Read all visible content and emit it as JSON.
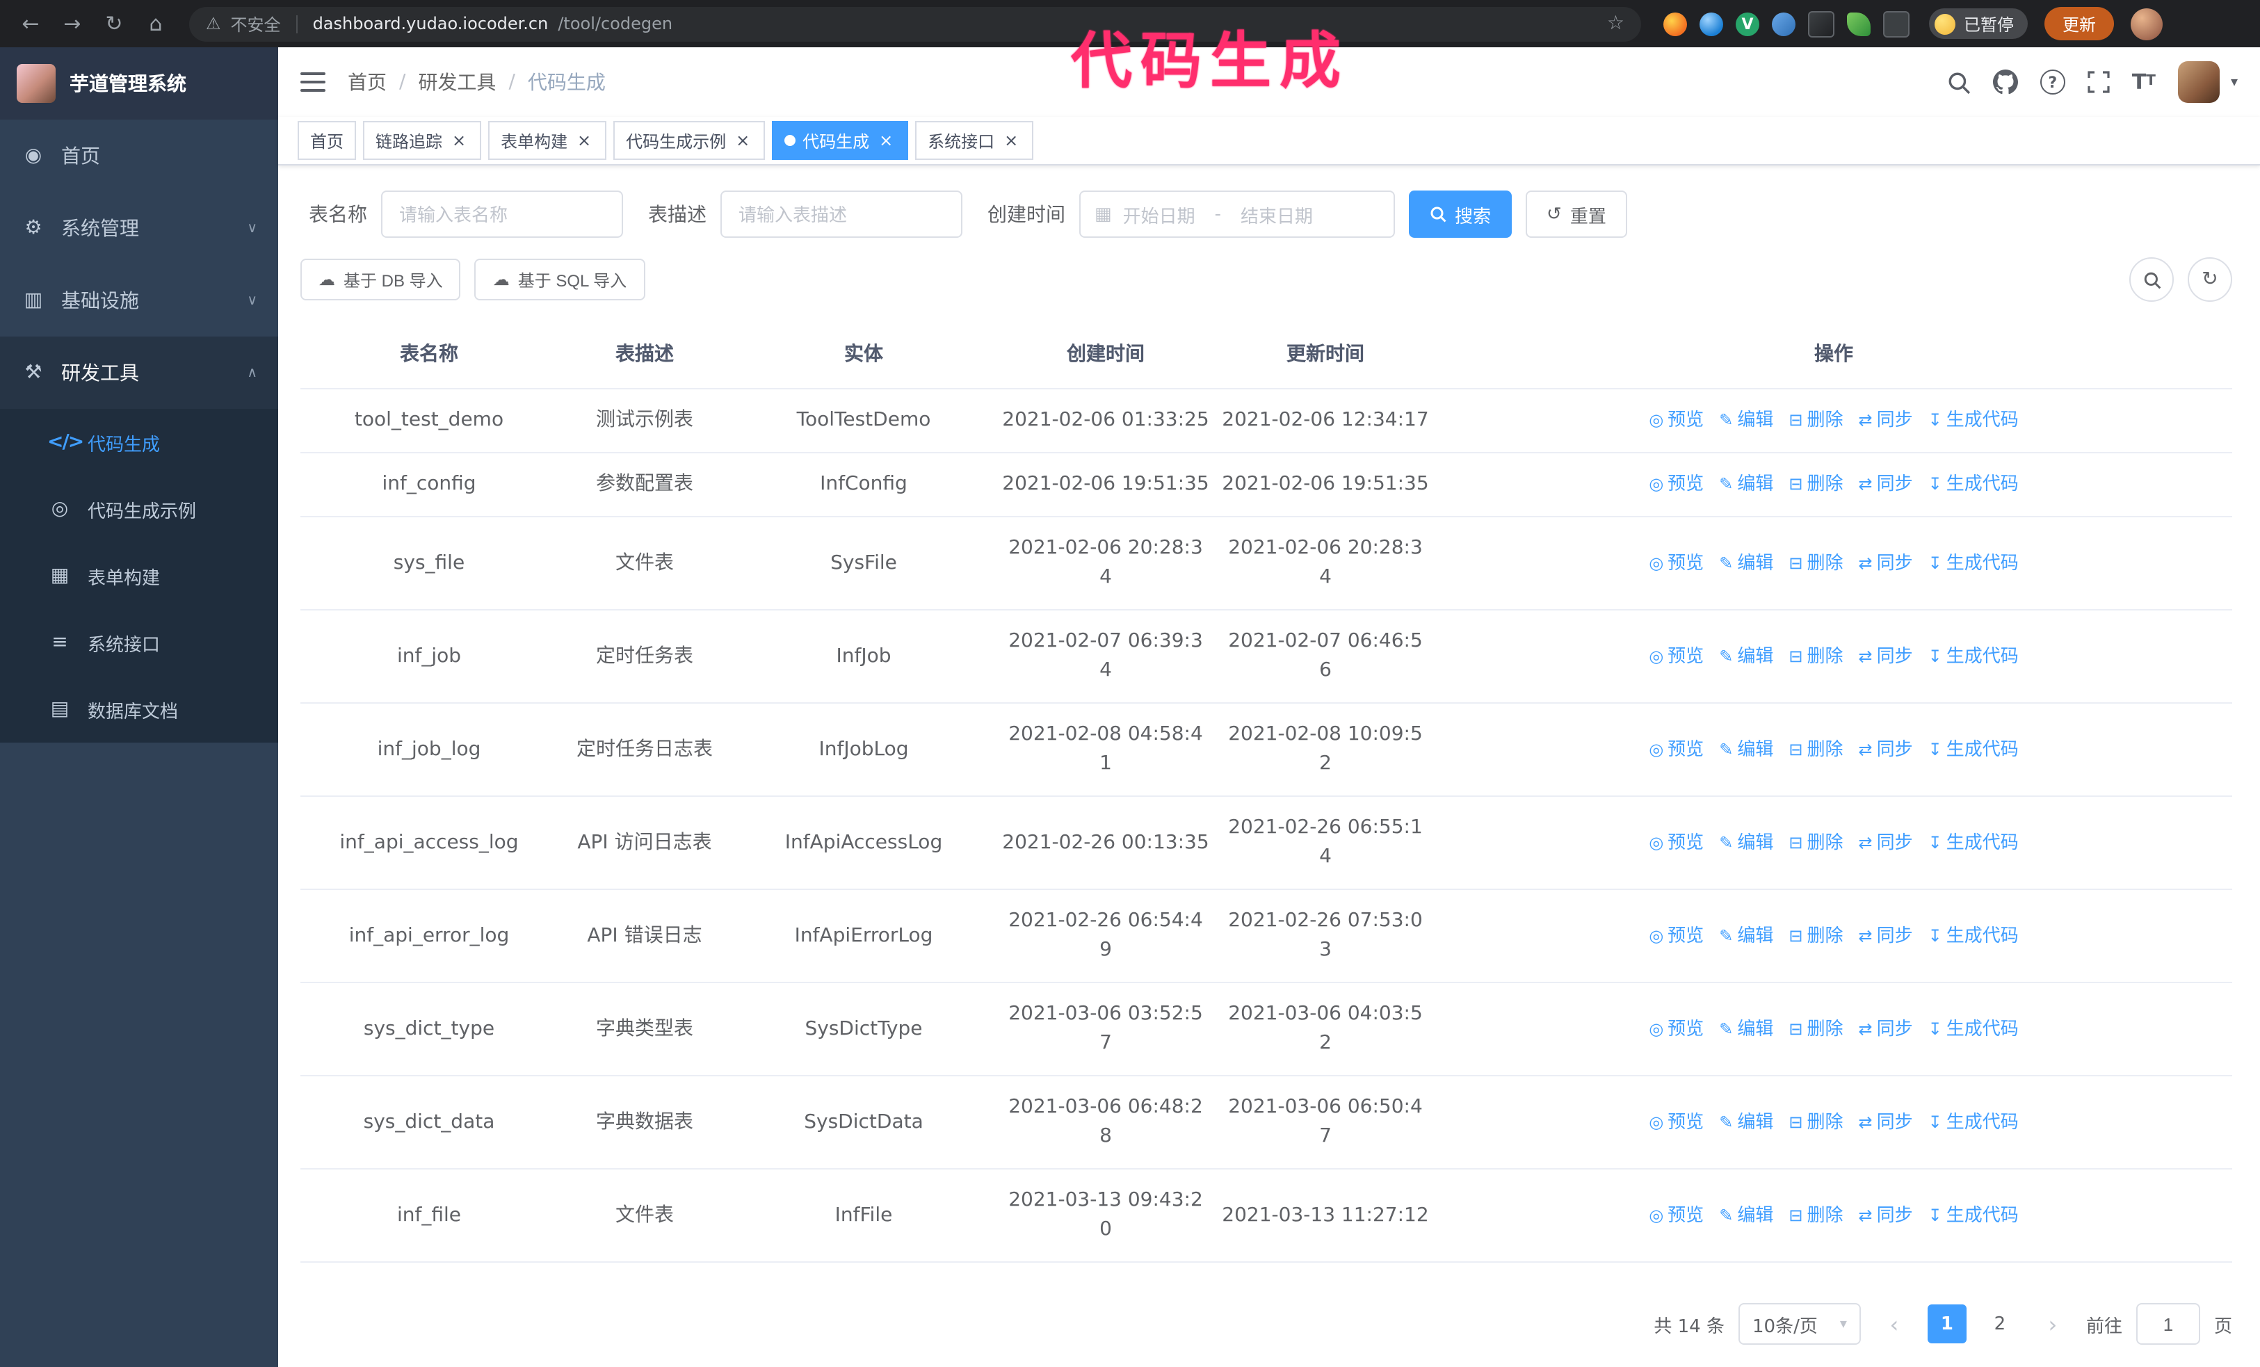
{
  "annotation": {
    "text": "代码生成",
    "color": "#ff2e6d"
  },
  "browser": {
    "security_label": "不安全",
    "url_domain": "dashboard.yudao.iocoder.cn",
    "url_path": "/tool/codegen",
    "paused_badge": "已暂停",
    "update_button": "更新"
  },
  "sidebar": {
    "logo_title": "芋道管理系统",
    "items": [
      {
        "label": "首页"
      },
      {
        "label": "系统管理"
      },
      {
        "label": "基础设施"
      },
      {
        "label": "研发工具"
      }
    ],
    "submenu": [
      {
        "label": "代码生成"
      },
      {
        "label": "代码生成示例"
      },
      {
        "label": "表单构建"
      },
      {
        "label": "系统接口"
      },
      {
        "label": "数据库文档"
      }
    ]
  },
  "header": {
    "breadcrumb": {
      "home": "首页",
      "section": "研发工具",
      "current": "代码生成"
    }
  },
  "tabs": [
    {
      "label": "首页"
    },
    {
      "label": "链路追踪"
    },
    {
      "label": "表单构建"
    },
    {
      "label": "代码生成示例"
    },
    {
      "label": "代码生成"
    },
    {
      "label": "系统接口"
    }
  ],
  "filters": {
    "table_name_label": "表名称",
    "table_name_placeholder": "请输入表名称",
    "table_desc_label": "表描述",
    "table_desc_placeholder": "请输入表描述",
    "create_time_label": "创建时间",
    "date_start_placeholder": "开始日期",
    "date_separator": "-",
    "date_end_placeholder": "结束日期",
    "search_button": "搜索",
    "reset_button": "重置"
  },
  "toolbar": {
    "import_db": "基于 DB 导入",
    "import_sql": "基于 SQL 导入"
  },
  "table": {
    "columns": [
      "表名称",
      "表描述",
      "实体",
      "创建时间",
      "更新时间",
      "操作"
    ],
    "actions": [
      "预览",
      "编辑",
      "删除",
      "同步",
      "生成代码"
    ],
    "rows": [
      {
        "name": "tool_test_demo",
        "desc": "测试示例表",
        "entity": "ToolTestDemo",
        "created": "2021-02-06 01:33:25",
        "updated": "2021-02-06 12:34:17"
      },
      {
        "name": "inf_config",
        "desc": "参数配置表",
        "entity": "InfConfig",
        "created": "2021-02-06 19:51:35",
        "updated": "2021-02-06 19:51:35"
      },
      {
        "name": "sys_file",
        "desc": "文件表",
        "entity": "SysFile",
        "created": "2021-02-06 20:28:34",
        "updated": "2021-02-06 20:28:34"
      },
      {
        "name": "inf_job",
        "desc": "定时任务表",
        "entity": "InfJob",
        "created": "2021-02-07 06:39:34",
        "updated": "2021-02-07 06:46:56"
      },
      {
        "name": "inf_job_log",
        "desc": "定时任务日志表",
        "entity": "InfJobLog",
        "created": "2021-02-08 04:58:41",
        "updated": "2021-02-08 10:09:52"
      },
      {
        "name": "inf_api_access_log",
        "desc": "API 访问日志表",
        "entity": "InfApiAccessLog",
        "created": "2021-02-26 00:13:35",
        "updated": "2021-02-26 06:55:14"
      },
      {
        "name": "inf_api_error_log",
        "desc": "API 错误日志",
        "entity": "InfApiErrorLog",
        "created": "2021-02-26 06:54:49",
        "updated": "2021-02-26 07:53:03"
      },
      {
        "name": "sys_dict_type",
        "desc": "字典类型表",
        "entity": "SysDictType",
        "created": "2021-03-06 03:52:57",
        "updated": "2021-03-06 04:03:52"
      },
      {
        "name": "sys_dict_data",
        "desc": "字典数据表",
        "entity": "SysDictData",
        "created": "2021-03-06 06:48:28",
        "updated": "2021-03-06 06:50:47"
      },
      {
        "name": "inf_file",
        "desc": "文件表",
        "entity": "InfFile",
        "created": "2021-03-13 09:43:20",
        "updated": "2021-03-13 11:27:12"
      }
    ]
  },
  "pagination": {
    "total": "共 14 条",
    "page_size": "10条/页",
    "page1": "1",
    "page2": "2",
    "goto_label": "前往",
    "goto_value": "1",
    "goto_suffix": "页"
  },
  "icons": {
    "back": "←",
    "forward": "→",
    "reload": "↻",
    "home": "⌂",
    "warning": "⚠",
    "star": "☆",
    "close": "×",
    "chevron_down": "∨",
    "chevron_up": "∧",
    "menu_home": "◉",
    "menu_system": "⚙",
    "menu_infra": "▥",
    "menu_dev": "⚒",
    "sub_codegen": "</>",
    "sub_demo": "◎",
    "sub_form": "▦",
    "sub_api": "≡",
    "sub_db": "▤",
    "v_badge": "V",
    "calendar": "▦",
    "reset": "↺",
    "upload": "☁",
    "refresh": "↻",
    "eye": "◎",
    "edit": "✎",
    "delete": "⊟",
    "sync": "⇄",
    "download": "↧",
    "prev": "‹",
    "next": "›",
    "caret": "▾",
    "fontsize_big": "T",
    "fontsize_small": "T",
    "help": "?"
  }
}
